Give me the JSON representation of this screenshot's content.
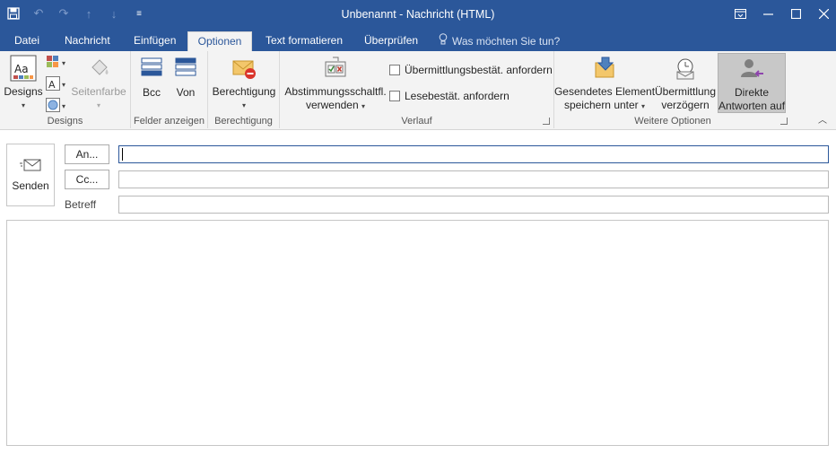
{
  "window": {
    "title": "Unbenannt - Nachricht (HTML)"
  },
  "qat": {
    "icons": [
      "save-icon",
      "undo-icon",
      "redo-icon",
      "arrow-up-icon",
      "arrow-down-icon",
      "customize-icon"
    ]
  },
  "window_controls": {
    "icons": [
      "ribbon-display-icon",
      "minimize-icon",
      "maximize-icon",
      "close-icon"
    ]
  },
  "tabs": [
    {
      "label": "Datei",
      "active": false
    },
    {
      "label": "Nachricht",
      "active": false
    },
    {
      "label": "Einfügen",
      "active": false
    },
    {
      "label": "Optionen",
      "active": true
    },
    {
      "label": "Text formatieren",
      "active": false
    },
    {
      "label": "Überprüfen",
      "active": false
    }
  ],
  "tell_me": {
    "placeholder": "Was möchten Sie tun?",
    "icon": "lightbulb-icon"
  },
  "ribbon": {
    "groups": {
      "designs": {
        "label": "Designs",
        "designs_button": "Designs",
        "seitenfarbe_button": "Seitenfarbe"
      },
      "felder": {
        "label": "Felder anzeigen",
        "bcc_button": "Bcc",
        "von_button": "Von"
      },
      "berechtigung": {
        "label": "Berechtigung",
        "berechtigung_button": "Berechtigung"
      },
      "verlauf": {
        "label": "Verlauf",
        "abstimmung_line1": "Abstimmungsschaltfl.",
        "abstimmung_line2": "verwenden",
        "check1": "Übermittlungsbestät. anfordern",
        "check2": "Lesebestät. anfordern"
      },
      "weitere": {
        "label": "Weitere Optionen",
        "gesendet_line1": "Gesendetes Element",
        "gesendet_line2": "speichern unter",
        "uebermittlung_line1": "Übermittlung",
        "uebermittlung_line2": "verzögern",
        "direkte_line1": "Direkte",
        "direkte_line2": "Antworten auf"
      }
    }
  },
  "compose": {
    "send_label": "Senden",
    "to_label": "An...",
    "cc_label": "Cc...",
    "subject_label": "Betreff",
    "to_value": "",
    "cc_value": "",
    "subject_value": "",
    "body_value": ""
  },
  "colors": {
    "accent": "#2b579a",
    "ribbon_bg": "#f3f3f3"
  }
}
